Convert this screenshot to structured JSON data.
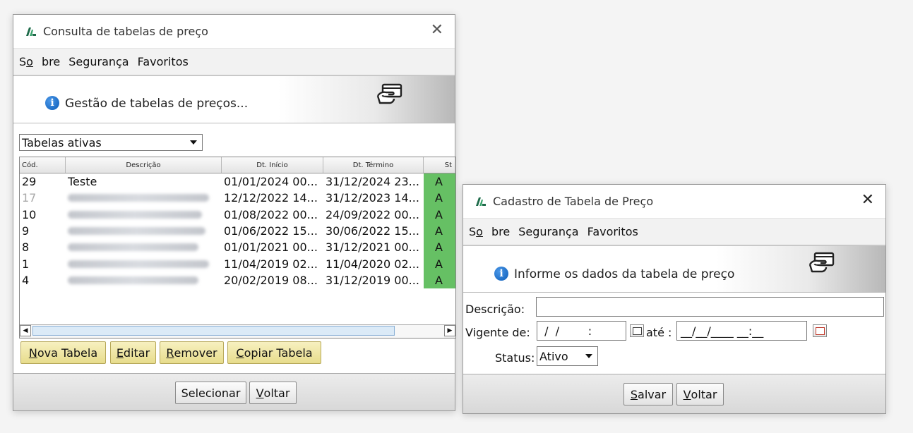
{
  "win1": {
    "title": "Consulta de tabelas de preço",
    "menu": [
      "Sobre",
      "Segurança",
      "Favoritos"
    ],
    "banner_text": "Gestão de tabelas de preços...",
    "filter_value": "Tabelas ativas",
    "columns": [
      "Cód.",
      "Descrição",
      "Dt. Início",
      "Dt. Término",
      "St"
    ],
    "rows": [
      {
        "cod": "29",
        "descricao": "Teste",
        "inicio": "01/01/2024 00...",
        "termino": "31/12/2024 23...",
        "status": "A"
      },
      {
        "cod": "17",
        "descricao": "",
        "inicio": "12/12/2022 14...",
        "termino": "31/12/2023 14...",
        "status": "A"
      },
      {
        "cod": "10",
        "descricao": "",
        "inicio": "01/08/2022 00...",
        "termino": "24/09/2022 00...",
        "status": "A"
      },
      {
        "cod": "9",
        "descricao": "",
        "inicio": "01/06/2022 15...",
        "termino": "30/06/2022 15...",
        "status": "A"
      },
      {
        "cod": "8",
        "descricao": "",
        "inicio": "01/01/2021 00...",
        "termino": "31/12/2021 00...",
        "status": "A"
      },
      {
        "cod": "1",
        "descricao": "",
        "inicio": "11/04/2019 02...",
        "termino": "11/04/2020 02...",
        "status": "A"
      },
      {
        "cod": "4",
        "descricao": "",
        "inicio": "20/02/2019 08...",
        "termino": "31/12/2019 00...",
        "status": "A"
      }
    ],
    "buttons": {
      "nova": "Nova Tabela",
      "editar": "Editar",
      "remover": "Remover",
      "copiar": "Copiar Tabela",
      "selecionar": "Selecionar",
      "voltar": "Voltar"
    },
    "status_color": "#66c064"
  },
  "win2": {
    "title": "Cadastro de Tabela de Preço",
    "menu": [
      "Sobre",
      "Segurança",
      "Favoritos"
    ],
    "banner_text": "Informe os dados da tabela de preço",
    "labels": {
      "descricao": "Descrição:",
      "vigente": "Vigente de:",
      "ate": "até :",
      "status": "Status:"
    },
    "fields": {
      "descricao": "",
      "vigente_de": " /  /        :  ",
      "ate": "__/__/____ __:__",
      "status": "Ativo"
    },
    "buttons": {
      "salvar": "Salvar",
      "voltar": "Voltar"
    }
  },
  "colors": {
    "logo": "#1e6b4a",
    "info": "#0b5cb8",
    "yellow_button": "#f1e7a8",
    "status_green": "#66c064"
  }
}
